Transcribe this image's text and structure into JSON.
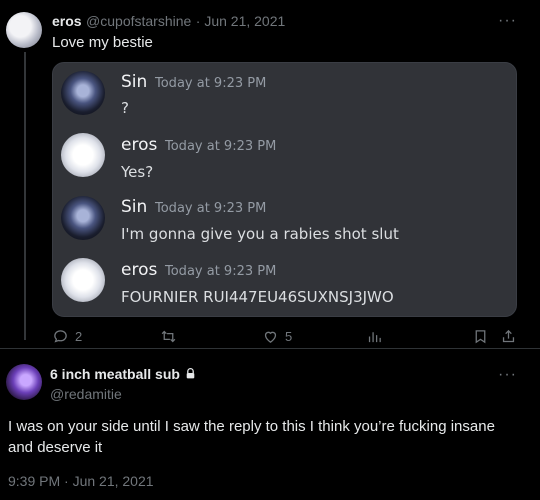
{
  "tweet": {
    "author_name": "eros",
    "handle": "@cupofstarshine",
    "date": "· Jun 21, 2021",
    "text": "Love my bestie",
    "more_icon": "···"
  },
  "discord": {
    "messages": [
      {
        "name": "Sin",
        "time": "Today at 9:23 PM",
        "text": "?"
      },
      {
        "name": "eros",
        "time": "Today at 9:23 PM",
        "text": "Yes?"
      },
      {
        "name": "Sin",
        "time": "Today at 9:23 PM",
        "text": "I'm gonna give you a rabies shot slut"
      },
      {
        "name": "eros",
        "time": "Today at 9:23 PM",
        "text": "FOURNIER RUI447EU46SUXNSJ3JWO"
      }
    ]
  },
  "actions": {
    "replies": "2",
    "retweets": "",
    "likes": "5"
  },
  "reply": {
    "author_name": "6 inch meatball sub",
    "handle": "@redamitie",
    "text_line1": "I was on your side until I saw the reply to this I think you’re fucking insane",
    "text_line2": "and deserve it",
    "timestamp": "9:39 PM · Jun 21, 2021",
    "more_icon": "···"
  }
}
